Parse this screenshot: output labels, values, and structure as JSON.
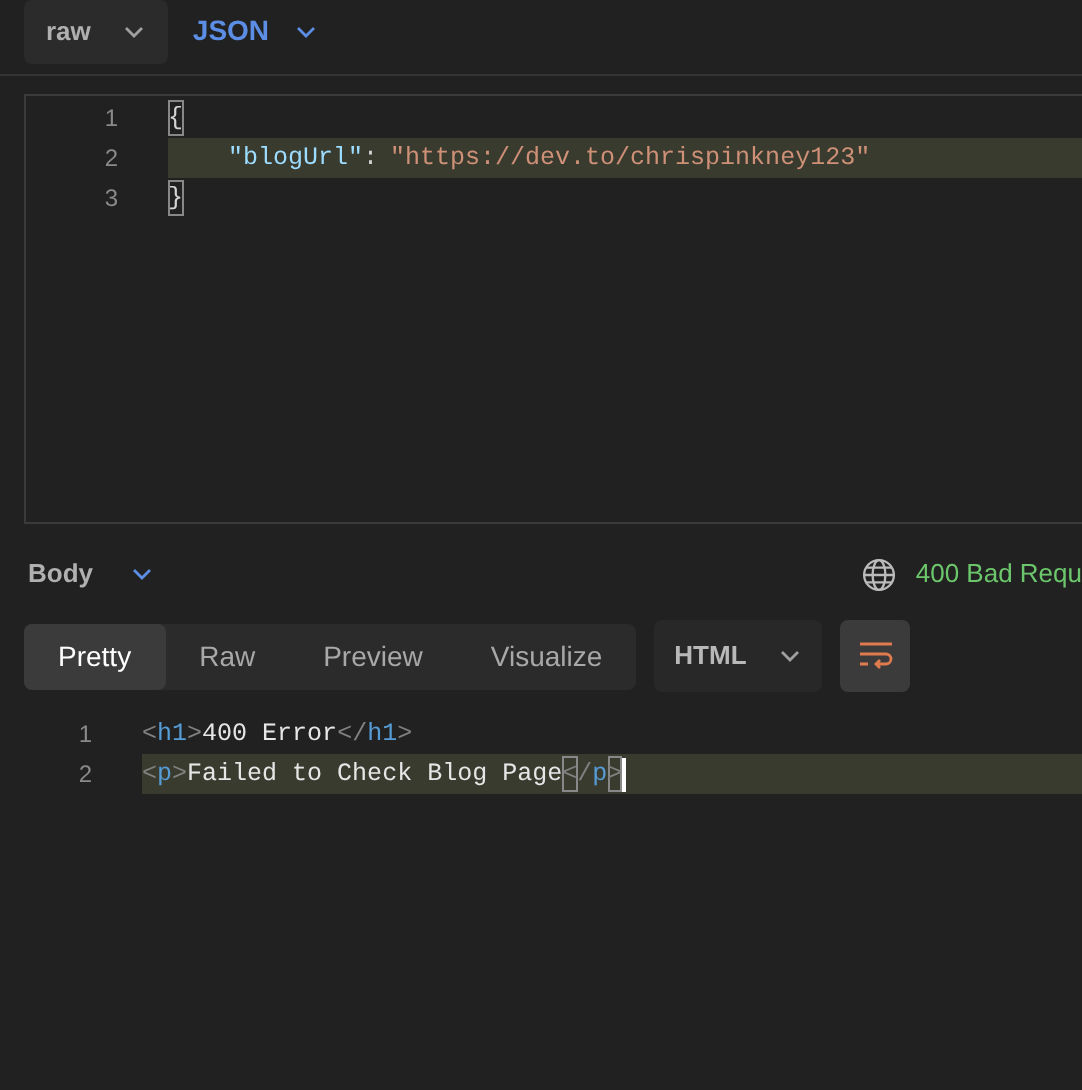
{
  "request_body": {
    "mode": {
      "label": "raw"
    },
    "language": {
      "label": "JSON"
    },
    "lines": [
      {
        "number": "1",
        "current": false,
        "tokens": [
          {
            "kind": "punct",
            "text": "{",
            "matched": true
          }
        ]
      },
      {
        "number": "2",
        "current": true,
        "tokens": [
          {
            "kind": "key",
            "text": "\"blogUrl\"",
            "matched": false
          },
          {
            "kind": "punct",
            "text": ":",
            "matched": false
          },
          {
            "kind": "string",
            "text": "\"https://dev.to/chrispinkney123\"",
            "matched": false
          }
        ]
      },
      {
        "number": "3",
        "current": false,
        "tokens": [
          {
            "kind": "punct",
            "text": "}",
            "matched": true
          }
        ]
      }
    ]
  },
  "response": {
    "section": {
      "label": "Body"
    },
    "status": "400 Bad Requ",
    "tabs": [
      {
        "label": "Pretty",
        "selected": true
      },
      {
        "label": "Raw",
        "selected": false
      },
      {
        "label": "Preview",
        "selected": false
      },
      {
        "label": "Visualize",
        "selected": false
      }
    ],
    "format": {
      "label": "HTML"
    },
    "wrap": {
      "on": true
    },
    "lines": [
      {
        "number": "1",
        "current": false,
        "cursor": false,
        "tokens": [
          {
            "kind": "bracket",
            "text": "<",
            "matched": false
          },
          {
            "kind": "tag",
            "text": "h1",
            "matched": false
          },
          {
            "kind": "bracket",
            "text": ">",
            "matched": false
          },
          {
            "kind": "text",
            "text": "400 Error",
            "matched": false
          },
          {
            "kind": "bracket",
            "text": "</",
            "matched": false
          },
          {
            "kind": "tag",
            "text": "h1",
            "matched": false
          },
          {
            "kind": "bracket",
            "text": ">",
            "matched": false
          }
        ]
      },
      {
        "number": "2",
        "current": true,
        "cursor": true,
        "tokens": [
          {
            "kind": "bracket",
            "text": "<",
            "matched": false
          },
          {
            "kind": "tag",
            "text": "p",
            "matched": false
          },
          {
            "kind": "bracket",
            "text": ">",
            "matched": false
          },
          {
            "kind": "text",
            "text": "Failed to Check Blog Page",
            "matched": false
          },
          {
            "kind": "bracket",
            "text": "<",
            "matched": true
          },
          {
            "kind": "bracket",
            "text": "/",
            "matched": false
          },
          {
            "kind": "tag",
            "text": "p",
            "matched": false
          },
          {
            "kind": "bracket",
            "text": ">",
            "matched": true
          }
        ]
      }
    ]
  }
}
